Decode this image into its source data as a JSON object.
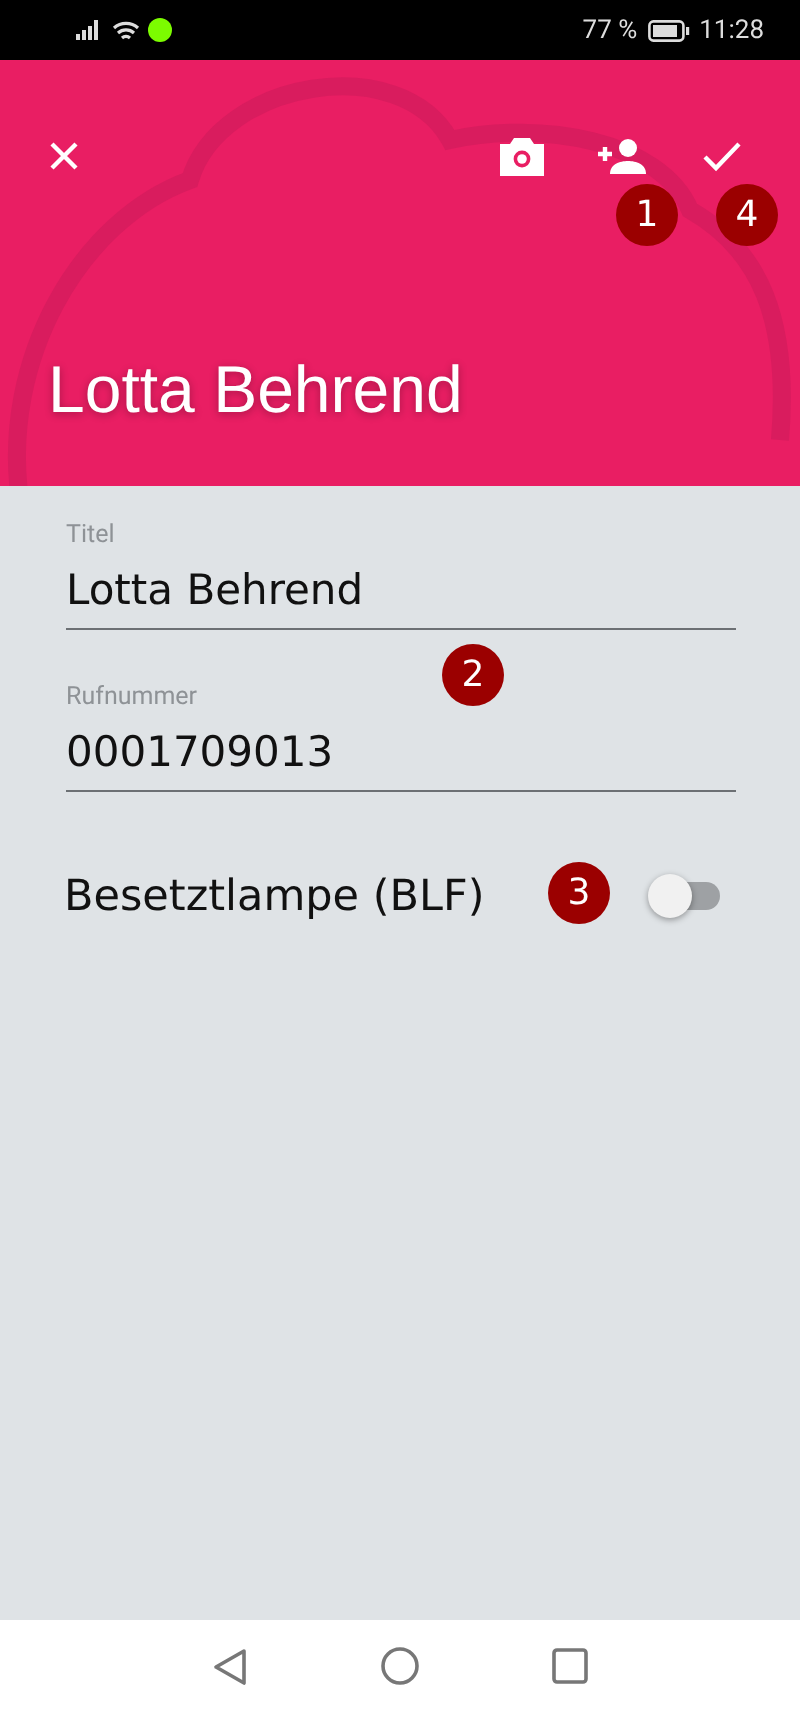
{
  "status_bar": {
    "battery": "77 %",
    "time": "11:28"
  },
  "header": {
    "title": "Lotta Behrend"
  },
  "fields": [
    {
      "label": "Titel",
      "value": "Lotta Behrend"
    },
    {
      "label": "Rufnummer",
      "value": "0001709013"
    }
  ],
  "toggle": {
    "label": "Besetztlampe (BLF)",
    "on": false
  },
  "callouts": [
    {
      "number": "1"
    },
    {
      "number": "4"
    },
    {
      "number": "2"
    },
    {
      "number": "3"
    }
  ]
}
